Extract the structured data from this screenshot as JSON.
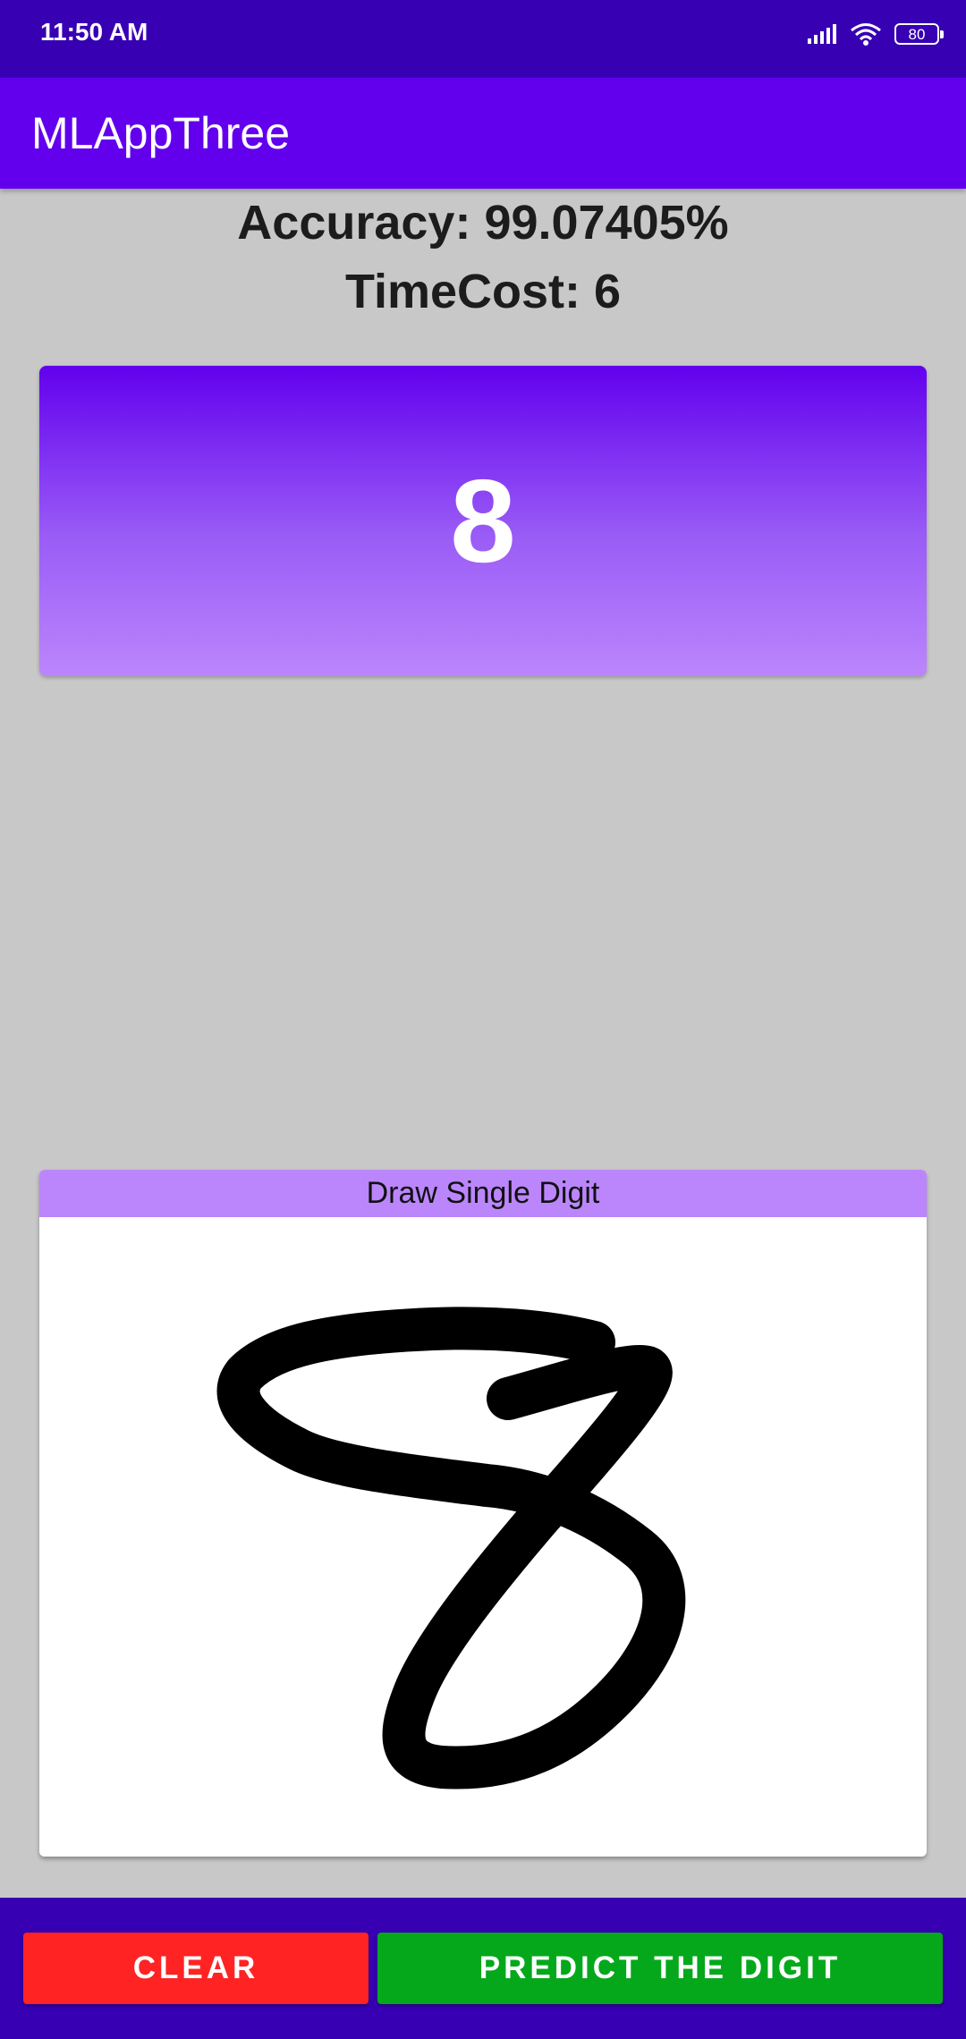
{
  "status_bar": {
    "time": "11:50 AM",
    "battery_level": "80",
    "icons": [
      "signal-icon",
      "wifi-icon",
      "battery-icon"
    ]
  },
  "app_bar": {
    "title": "MLAppThree"
  },
  "results": {
    "accuracy": "Accuracy: 99.07405%",
    "timecost": "TimeCost: 6",
    "predicted_digit": "8"
  },
  "drawing": {
    "header": "Draw Single Digit"
  },
  "actions": {
    "clear_label": "CLEAR",
    "predict_label": "PREDICT THE DIGIT"
  },
  "colors": {
    "status_bar": "#3700b3",
    "primary": "#6200ee",
    "accent_light": "#bb86fc",
    "clear_button": "#ff2323",
    "predict_button": "#05a81b",
    "background": "#c8c8c8"
  }
}
